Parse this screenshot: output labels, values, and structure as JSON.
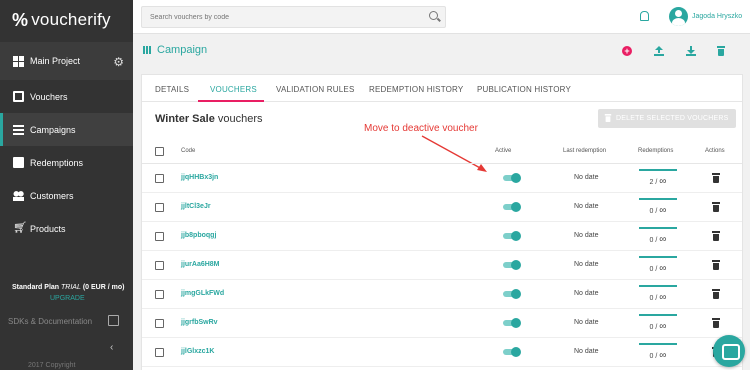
{
  "brand": {
    "logo_symbol": "%",
    "name": "voucherify",
    "accent": "#2aa7a0",
    "sidebar_bg": "#333333",
    "pink": "#e91e63"
  },
  "sidebar": {
    "project": {
      "label": "Main Project",
      "icon": "grid-icon"
    },
    "items": [
      {
        "label": "Vouchers",
        "icon": "voucher-box-icon"
      },
      {
        "label": "Campaigns",
        "icon": "list-icon",
        "active": true
      },
      {
        "label": "Redemptions",
        "icon": "document-icon"
      },
      {
        "label": "Customers",
        "icon": "people-icon"
      },
      {
        "label": "Products",
        "icon": "cart-icon"
      }
    ],
    "plan_name": "Standard Plan",
    "plan_type": "TRIAL",
    "plan_price": "(0 EUR / mo)",
    "upgrade": "UPGRADE",
    "sdk": "SDKs & Documentation",
    "collapse_glyph": "‹",
    "copyright": "2017 Copyright"
  },
  "topbar": {
    "search_placeholder": "Search vouchers by code",
    "user_name": "Jagoda Hryszko"
  },
  "campaign": {
    "title": "Campaign",
    "add_glyph": "+"
  },
  "tabs": [
    "DETAILS",
    "VOUCHERS",
    "VALIDATION RULES",
    "REDEMPTION HISTORY",
    "PUBLICATION HISTORY"
  ],
  "active_tab": "VOUCHERS",
  "section": {
    "name": "Winter Sale",
    "suffix": "vouchers"
  },
  "delete_selected": "DELETE SELECTED VOUCHERS",
  "annotation": "Move to deactive voucher",
  "table": {
    "headers": {
      "code": "Code",
      "active": "Active",
      "last_redemption": "Last redemption",
      "redemptions": "Redemptions",
      "actions": "Actions"
    },
    "rows": [
      {
        "code": "jjqHHBx3jn",
        "active": true,
        "last_redemption": "No date",
        "redeemed": "2",
        "limit": "∞"
      },
      {
        "code": "jjltCl3eJr",
        "active": true,
        "last_redemption": "No date",
        "redeemed": "0",
        "limit": "∞"
      },
      {
        "code": "jjb8pboqgj",
        "active": true,
        "last_redemption": "No date",
        "redeemed": "0",
        "limit": "∞"
      },
      {
        "code": "jjurAa6H8M",
        "active": true,
        "last_redemption": "No date",
        "redeemed": "0",
        "limit": "∞"
      },
      {
        "code": "jjmgGLkFWd",
        "active": true,
        "last_redemption": "No date",
        "redeemed": "0",
        "limit": "∞"
      },
      {
        "code": "jjgrfbSwRv",
        "active": true,
        "last_redemption": "No date",
        "redeemed": "0",
        "limit": "∞"
      },
      {
        "code": "jjlGlxzc1K",
        "active": true,
        "last_redemption": "No date",
        "redeemed": "0",
        "limit": "∞"
      }
    ]
  }
}
